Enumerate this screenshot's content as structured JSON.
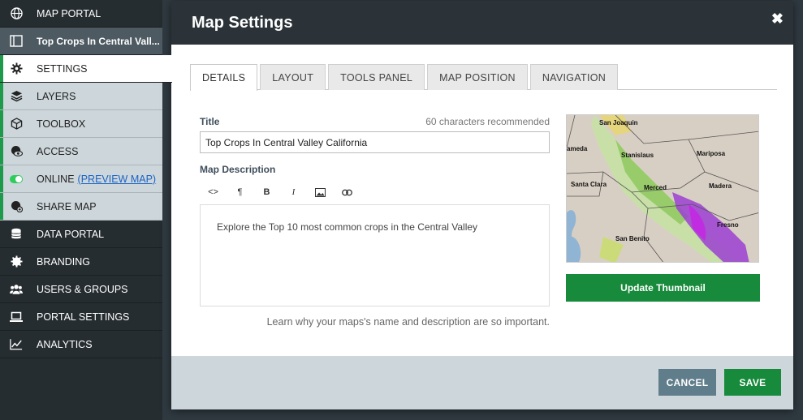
{
  "sidebar": {
    "map_portal": "MAP PORTAL",
    "current_map": "Top Crops In Central Vall...",
    "settings": "SETTINGS",
    "layers": "LAYERS",
    "toolbox": "TOOLBOX",
    "access": "ACCESS",
    "online": "ONLINE",
    "preview_map": "(PREVIEW MAP)",
    "share_map": "SHARE MAP",
    "data_portal": "DATA PORTAL",
    "branding": "BRANDING",
    "users_groups": "USERS & GROUPS",
    "portal_settings": "PORTAL SETTINGS",
    "analytics": "ANALYTICS"
  },
  "modal": {
    "title": "Map Settings",
    "close_symbol": "✖",
    "tabs": [
      "DETAILS",
      "LAYOUT",
      "TOOLS PANEL",
      "MAP POSITION",
      "NAVIGATION"
    ],
    "title_label": "Title",
    "title_hint": "60 characters recommended",
    "title_value": "Top Crops In Central Valley California",
    "description_label": "Map Description",
    "toolbar": {
      "code": "<>",
      "paragraph": "¶",
      "bold": "B",
      "italic": "I"
    },
    "description_value": "Explore the Top 10 most common crops in the Central Valley",
    "learn_text": "Learn why your maps's name and description are so important.",
    "thumbnail_labels": [
      "San Joaquin",
      "ameda",
      "Stanislaus",
      "Mariposa",
      "Santa Clara",
      "Merced",
      "Madera",
      "Fresno",
      "San Benito"
    ],
    "update_thumbnail": "Update Thumbnail",
    "cancel": "CANCEL",
    "save": "SAVE"
  },
  "colors": {
    "accent_green": "#188a3c",
    "header_dark": "#2b3338",
    "sidebar_dark": "#262d31",
    "cancel_gray": "#607d8b"
  }
}
